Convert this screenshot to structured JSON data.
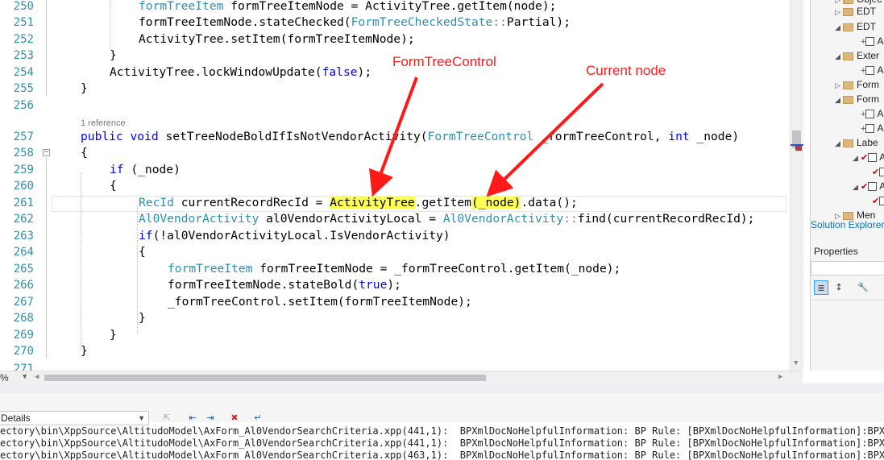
{
  "editor": {
    "lines": [
      {
        "num": "250",
        "indent": 3,
        "tokens": [
          {
            "t": "formTreeItem",
            "c": "ty"
          },
          {
            "t": " formTreeItemNode = ActivityTree.getItem(node);"
          }
        ]
      },
      {
        "num": "251",
        "indent": 3,
        "tokens": [
          {
            "t": "formTreeItemNode.stateChecked("
          },
          {
            "t": "FormTreeCheckedState",
            "c": "ty"
          },
          {
            "t": "::",
            "c": "gr"
          },
          {
            "t": "Partial);"
          }
        ]
      },
      {
        "num": "252",
        "indent": 3,
        "tokens": [
          {
            "t": "ActivityTree.setItem(formTreeItemNode);"
          }
        ]
      },
      {
        "num": "253",
        "indent": 2,
        "tokens": [
          {
            "t": "}"
          }
        ]
      },
      {
        "num": "254",
        "indent": 2,
        "tokens": [
          {
            "t": "ActivityTree.lockWindowUpdate("
          },
          {
            "t": "false",
            "c": "kw"
          },
          {
            "t": ");"
          }
        ]
      },
      {
        "num": "255",
        "indent": 1,
        "tokens": [
          {
            "t": "}"
          }
        ]
      },
      {
        "num": "256",
        "indent": 0,
        "tokens": []
      },
      {
        "num": "257",
        "indent": 1,
        "tokens": [
          {
            "t": "public",
            "c": "kw"
          },
          {
            "t": " "
          },
          {
            "t": "void",
            "c": "kw"
          },
          {
            "t": " setTreeNodeBoldIfIsNotVendorActivity("
          },
          {
            "t": "FormTreeControl",
            "c": "ty"
          },
          {
            "t": " _formTreeControl, "
          },
          {
            "t": "int",
            "c": "kw"
          },
          {
            "t": " _node)"
          }
        ]
      },
      {
        "num": "258",
        "indent": 1,
        "tokens": [
          {
            "t": "{"
          }
        ]
      },
      {
        "num": "259",
        "indent": 2,
        "tokens": [
          {
            "t": "if",
            "c": "kw"
          },
          {
            "t": " (_node)"
          }
        ]
      },
      {
        "num": "260",
        "indent": 2,
        "tokens": [
          {
            "t": "{"
          }
        ]
      },
      {
        "num": "261",
        "indent": 3,
        "tokens": [
          {
            "t": "RecId",
            "c": "ty"
          },
          {
            "t": " currentRecordRecId = "
          },
          {
            "t": "ActivityTree",
            "c": "hl"
          },
          {
            "t": ".getItem"
          },
          {
            "t": "(_node)",
            "c": "hl"
          },
          {
            "t": ".data();"
          }
        ]
      },
      {
        "num": "262",
        "indent": 3,
        "tokens": [
          {
            "t": "Al0VendorActivity",
            "c": "ty"
          },
          {
            "t": " al0VendorActivityLocal = "
          },
          {
            "t": "Al0VendorActivity",
            "c": "ty"
          },
          {
            "t": "::",
            "c": "gr"
          },
          {
            "t": "find(currentRecordRecId);"
          }
        ]
      },
      {
        "num": "263",
        "indent": 3,
        "tokens": [
          {
            "t": "if",
            "c": "kw"
          },
          {
            "t": "(!al0VendorActivityLocal.IsVendorActivity)"
          }
        ]
      },
      {
        "num": "264",
        "indent": 3,
        "tokens": [
          {
            "t": "{"
          }
        ]
      },
      {
        "num": "265",
        "indent": 4,
        "tokens": [
          {
            "t": "formTreeItem",
            "c": "ty"
          },
          {
            "t": " formTreeItemNode = _formTreeControl.getItem(_node);"
          }
        ]
      },
      {
        "num": "266",
        "indent": 4,
        "tokens": [
          {
            "t": "formTreeItemNode.stateBold("
          },
          {
            "t": "true",
            "c": "kw"
          },
          {
            "t": ");"
          }
        ]
      },
      {
        "num": "267",
        "indent": 4,
        "tokens": [
          {
            "t": "_formTreeControl.setItem(formTreeItemNode);"
          }
        ]
      },
      {
        "num": "268",
        "indent": 3,
        "tokens": [
          {
            "t": "}"
          }
        ]
      },
      {
        "num": "269",
        "indent": 2,
        "tokens": [
          {
            "t": "}"
          }
        ]
      },
      {
        "num": "270",
        "indent": 1,
        "tokens": [
          {
            "t": "}"
          }
        ]
      },
      {
        "num": "271",
        "indent": 0,
        "tokens": []
      }
    ],
    "reference_label": "1 reference",
    "zoom": "%"
  },
  "annotations": {
    "label1": "FormTreeControl",
    "label2": "Current node"
  },
  "solution_explorer": {
    "rows": [
      {
        "label": "Objec",
        "type": "folder",
        "tri": "▷",
        "check": false
      },
      {
        "label": "EDT",
        "type": "folder",
        "tri": "▷",
        "check": false
      },
      {
        "label": "EDT",
        "type": "folder",
        "tri": "◢",
        "check": false
      },
      {
        "label": "A",
        "type": "file",
        "tri": "+",
        "check": false
      },
      {
        "label": "Exter",
        "type": "folder",
        "tri": "◢",
        "check": false
      },
      {
        "label": "A",
        "type": "file",
        "tri": "+",
        "check": false
      },
      {
        "label": "Form",
        "type": "folder",
        "tri": "▷",
        "check": false
      },
      {
        "label": "Form",
        "type": "folder",
        "tri": "◢",
        "check": false
      },
      {
        "label": "A",
        "type": "file",
        "tri": "+",
        "check": false
      },
      {
        "label": "A",
        "type": "file",
        "tri": "+",
        "check": false
      },
      {
        "label": "Labe",
        "type": "folder",
        "tri": "◢",
        "check": false
      },
      {
        "label": "A",
        "type": "file",
        "tri": "◢",
        "check": true
      },
      {
        "label": "",
        "type": "file",
        "tri": "",
        "check": true
      },
      {
        "label": "A",
        "type": "file",
        "tri": "◢",
        "check": true
      },
      {
        "label": "",
        "type": "file",
        "tri": "",
        "check": true
      },
      {
        "label": "Men",
        "type": "folder",
        "tri": "▷",
        "check": false
      }
    ],
    "tab_label": "Solution Explorer"
  },
  "properties": {
    "title": "Properties"
  },
  "output": {
    "show_output_from": "Details",
    "lines": [
      "ectory\\bin\\XppSource\\AltitudoModel\\AxForm_Al0VendorSearchCriteria.xpp(441,1):  BPXmlDocNoHelpfulInformation: BP Rule: [BPXmlDocNoHelpfulInformation]:BPXmlDocNo",
      "ectory\\bin\\XppSource\\AltitudoModel\\AxForm_Al0VendorSearchCriteria.xpp(441,1):  BPXmlDocNoHelpfulInformation: BP Rule: [BPXmlDocNoHelpfulInformation]:BPXmlDocNo",
      "ectory\\bin\\XppSource\\AltitudoModel\\AxForm_Al0VendorSearchCriteria.xpp(463,1):  BPXmlDocNoHelpfulInformation: BP Rule: [BPXmlDocNoHelpfulInformation]:BPXmlDocNo"
    ]
  },
  "icons": {
    "prev_message": "go-to-previous-message-icon",
    "next_message": "go-to-next-message-icon",
    "clear_all": "clear-all-icon",
    "word_wrap": "word-wrap-icon"
  },
  "colors": {
    "keyword": "#0000ff",
    "type": "#2b91af",
    "line_number": "#2b91af",
    "highlight": "#ffff55",
    "annotation": "#ff1a1a"
  }
}
